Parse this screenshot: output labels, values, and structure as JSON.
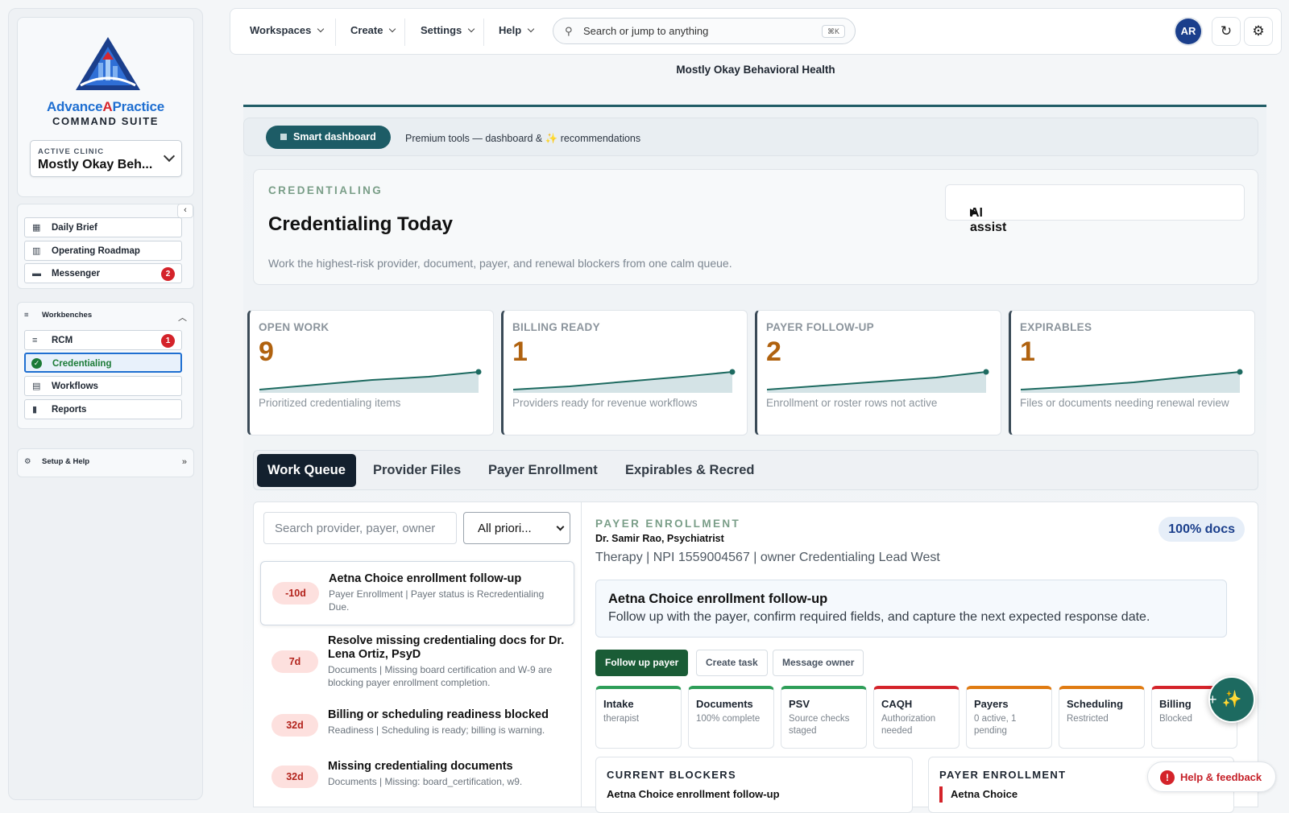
{
  "brand": {
    "name_a": "Advance",
    "name_b": "A",
    "name_c": "Practice",
    "subtitle": "COMMAND SUITE"
  },
  "clinic": {
    "label": "ACTIVE CLINIC",
    "value": "Mostly Okay Beh..."
  },
  "nav_primary": [
    {
      "label": "Daily Brief",
      "icon": "grid-icon"
    },
    {
      "label": "Operating Roadmap",
      "icon": "map-icon"
    },
    {
      "label": "Messenger",
      "icon": "chat-icon",
      "badge": "2"
    }
  ],
  "workbenches": {
    "title": "Workbenches",
    "items": [
      {
        "label": "RCM",
        "badge": "1"
      },
      {
        "label": "Credentialing",
        "active": true
      },
      {
        "label": "Workflows"
      },
      {
        "label": "Reports"
      }
    ]
  },
  "setup": {
    "title": "Setup & Help"
  },
  "topbar": {
    "menus": [
      "Workspaces",
      "Create",
      "Settings",
      "Help"
    ],
    "search_placeholder": "Search or jump to anything",
    "search_shortcut": "⌘K",
    "avatar": "AR"
  },
  "org_name": "Mostly Okay Behavioral Health",
  "ribbon": {
    "button": "Smart dashboard",
    "text_a": "Premium tools — dashboard &",
    "text_b": "recommendations"
  },
  "header": {
    "eyebrow": "CREDENTIALING",
    "title": "Credentialing Today",
    "description": "Work the highest-risk provider, document, payer, and renewal blockers from one calm queue.",
    "ai_assist": "AI assist"
  },
  "kpis": [
    {
      "label": "OPEN WORK",
      "value": "9",
      "desc": "Prioritized credentialing items"
    },
    {
      "label": "BILLING READY",
      "value": "1",
      "desc": "Providers ready for revenue workflows"
    },
    {
      "label": "PAYER FOLLOW-UP",
      "value": "2",
      "desc": "Enrollment or roster rows not active"
    },
    {
      "label": "EXPIRABLES",
      "value": "1",
      "desc": "Files or documents needing renewal review"
    }
  ],
  "tabs": [
    "Work Queue",
    "Provider Files",
    "Payer Enrollment",
    "Expirables & Recred"
  ],
  "queue": {
    "search_placeholder": "Search provider, payer, owner",
    "filter": "All priori...",
    "items": [
      {
        "pill": "-10d",
        "title": "Aetna Choice enrollment follow-up",
        "sub": "Payer Enrollment | Payer status is Recredentialing Due."
      },
      {
        "pill": "7d",
        "title": "Resolve missing credentialing docs for Dr. Lena Ortiz, PsyD",
        "sub": "Documents | Missing board certification and W-9 are blocking payer enrollment completion."
      },
      {
        "pill": "32d",
        "title": "Billing or scheduling readiness blocked",
        "sub": "Readiness | Scheduling is ready; billing is warning."
      },
      {
        "pill": "32d",
        "title": "Missing credentialing documents",
        "sub": "Documents | Missing: board_certification, w9."
      }
    ]
  },
  "detail": {
    "eyebrow": "PAYER ENROLLMENT",
    "provider": "Dr. Samir Rao, Psychiatrist",
    "meta": "Therapy | NPI 1559004567 | owner Credentialing Lead West",
    "docs_badge": "100% docs",
    "task_title": "Aetna Choice enrollment follow-up",
    "task_desc": "Follow up with the payer, confirm required fields, and capture the next expected response date.",
    "buttons": [
      "Follow up payer",
      "Create task",
      "Message owner"
    ],
    "stages": [
      {
        "name": "Intake",
        "value": "therapist",
        "color": "#2e9e58"
      },
      {
        "name": "Documents",
        "value": "100% complete",
        "color": "#2e9e58"
      },
      {
        "name": "PSV",
        "value": "Source checks staged",
        "color": "#2e9e58"
      },
      {
        "name": "CAQH",
        "value": "Authorization needed",
        "color": "#d4232a"
      },
      {
        "name": "Payers",
        "value": "0 active, 1 pending",
        "color": "#e07b12"
      },
      {
        "name": "Scheduling",
        "value": "Restricted",
        "color": "#e07b12"
      },
      {
        "name": "Billing",
        "value": "Blocked",
        "color": "#d4232a"
      }
    ],
    "blockers_title": "CURRENT BLOCKERS",
    "blockers_first": "Aetna Choice enrollment follow-up",
    "enroll_title": "PAYER ENROLLMENT",
    "enroll_first": "Aetna Choice"
  },
  "help_button": "Help & feedback"
}
